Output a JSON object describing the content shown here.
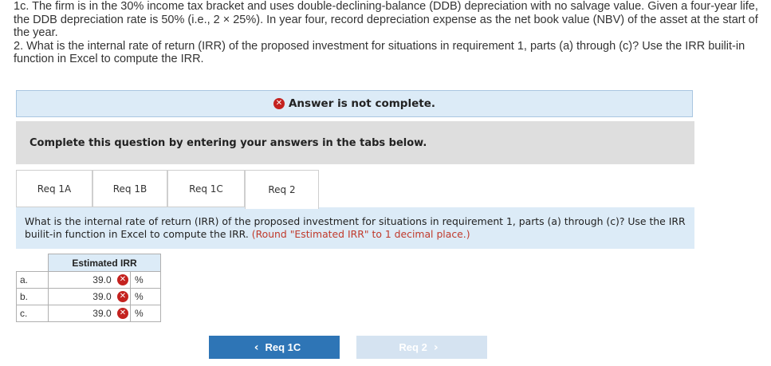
{
  "intro": {
    "line1": "1c. The firm is in the 30% income tax bracket and uses double-declining-balance (DDB) depreciation with no salvage value. Given a four-year life, the DDB depreciation rate is 50% (i.e., 2 × 25%). In year four, record depreciation expense as the net book value (NBV) of the asset at the start of the year.",
    "line2": "2. What is the internal rate of return (IRR) of the proposed investment for situations in requirement 1, parts (a) through (c)? Use the IRR builit-in function in Excel to compute the IRR."
  },
  "banner": {
    "text": "Answer is not complete.",
    "icon": "x-circle-icon",
    "icon_glyph": "✕"
  },
  "instruction": "Complete this question by entering your answers in the tabs below.",
  "tabs": [
    {
      "label": "Req 1A"
    },
    {
      "label": "Req 1B"
    },
    {
      "label": "Req 1C"
    },
    {
      "label": "Req 2"
    }
  ],
  "active_tab": "Req 2",
  "question": {
    "text": "What is the internal rate of return (IRR) of the proposed investment for situations in requirement 1, parts (a) through (c)? Use the IRR builit-in function in Excel to compute the IRR.",
    "note": "(Round \"Estimated IRR\" to 1 decimal place.)"
  },
  "table": {
    "header": "Estimated IRR",
    "rows": [
      {
        "label": "a.",
        "value": "39.0",
        "unit": "%",
        "status": "incorrect"
      },
      {
        "label": "b.",
        "value": "39.0",
        "unit": "%",
        "status": "incorrect"
      },
      {
        "label": "c.",
        "value": "39.0",
        "unit": "%",
        "status": "incorrect"
      }
    ]
  },
  "nav": {
    "prev_label": "Req 1C",
    "next_label": "Req 2",
    "prev_icon": "‹",
    "next_icon": "›"
  },
  "colors": {
    "accent": "#2e75b6",
    "error": "#c4221f",
    "panel": "#dcebf7",
    "instruction_bg": "#dedede"
  }
}
